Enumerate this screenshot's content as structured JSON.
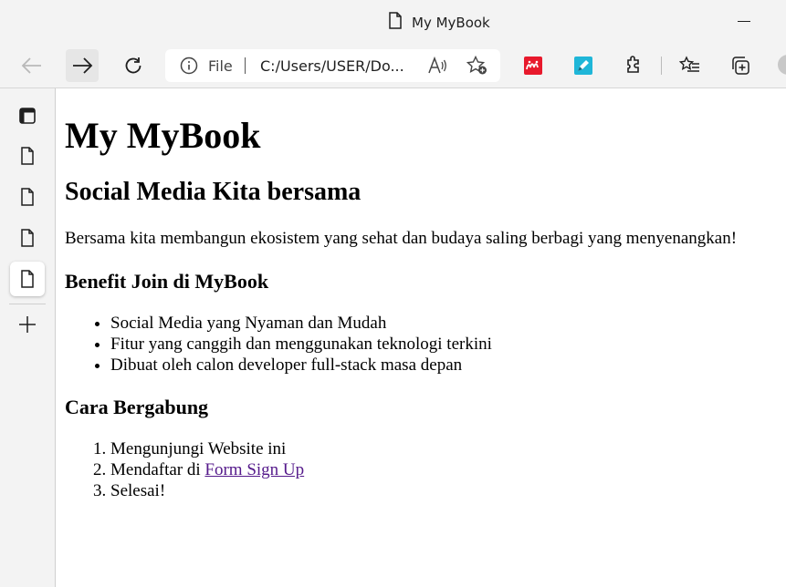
{
  "window": {
    "title": "My MyBook"
  },
  "addressbar": {
    "scheme_label": "File",
    "url": "C:/Users/USER/Do..."
  },
  "page": {
    "h1": "My MyBook",
    "h2": "Social Media Kita bersama",
    "intro": "Bersama kita membangun ekosistem yang sehat dan budaya saling berbagi yang menyenangkan!",
    "benefit_heading": "Benefit Join di MyBook",
    "benefits": [
      "Social Media yang Nyaman dan Mudah",
      "Fitur yang canggih dan menggunakan teknologi terkini",
      "Dibuat oleh calon developer full-stack masa depan"
    ],
    "join_heading": "Cara Bergabung",
    "steps": {
      "step1": "Mengunjungi Website ini",
      "step2_prefix": "Mendaftar di ",
      "step2_link": "Form Sign Up",
      "step3": "Selesai!"
    }
  },
  "colors": {
    "link_visited": "#551a8b",
    "ext1": "#e8192c",
    "ext2": "#1fb6d8"
  },
  "icons": {
    "toolbar": [
      "back-icon",
      "forward-icon",
      "refresh-icon",
      "info-icon",
      "read-aloud-icon",
      "add-favorite-icon",
      "extension-mendeley-icon",
      "extension-pen-icon",
      "extensions-icon",
      "favorites-icon",
      "collections-icon",
      "profile-icon"
    ],
    "sidebar": [
      "tab-actions-icon",
      "page-icon",
      "page-icon",
      "page-icon",
      "page-icon",
      "new-tab-icon"
    ]
  }
}
